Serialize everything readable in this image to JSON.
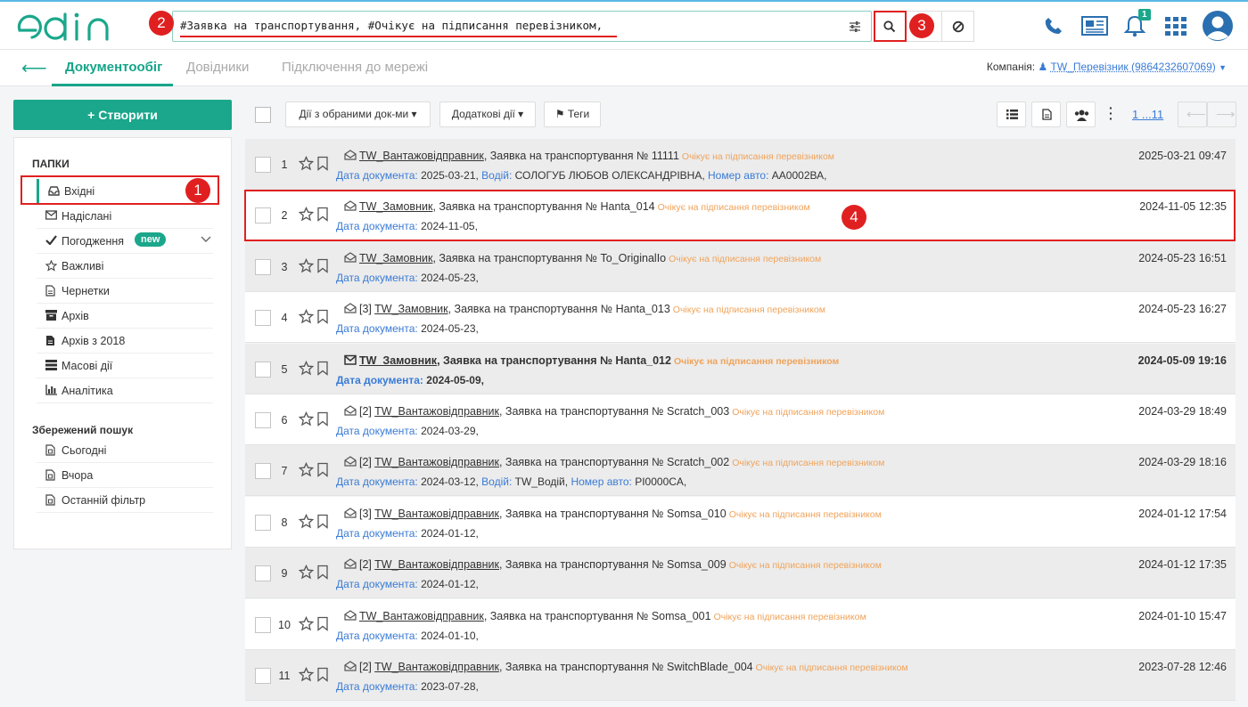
{
  "search": {
    "query": "#Заявка на транспортування, #Очікує на підписання перевізником,"
  },
  "markers": [
    "1",
    "2",
    "3",
    "4"
  ],
  "header": {
    "notifications_count": "1"
  },
  "nav": {
    "tabs": [
      "Документообіг",
      "Довідники",
      "Підключення до мережі"
    ],
    "company_label": "Компанія:",
    "company_value": "TW_Перевізник (9864232607069)"
  },
  "sidebar": {
    "create_label": "+ Створити",
    "folders_title": "ПАПКИ",
    "folders": [
      {
        "label": "Вхідні",
        "icon": "inbox-icon"
      },
      {
        "label": "Надіслані",
        "icon": "envelope-icon"
      },
      {
        "label": "Погодження",
        "icon": "check-icon",
        "badge": "new"
      },
      {
        "label": "Важливі",
        "icon": "star-icon"
      },
      {
        "label": "Чернетки",
        "icon": "draft-icon"
      },
      {
        "label": "Архів",
        "icon": "archive-icon"
      },
      {
        "label": "Архів з 2018",
        "icon": "archive-doc-icon"
      },
      {
        "label": "Масові дії",
        "icon": "bulk-icon"
      },
      {
        "label": "Аналітика",
        "icon": "chart-icon"
      }
    ],
    "saved_title": "Збережений пошук",
    "saved": [
      "Сьогодні",
      "Вчора",
      "Останній фільтр"
    ]
  },
  "toolbar": {
    "actions_label": "Дії з обраними док-ми ▾",
    "extra_label": "Додаткові дії ▾",
    "tags_label": "Теги",
    "pager": "1 ...11"
  },
  "rows": [
    {
      "num": "1",
      "prefix": "",
      "sender": "TW_Вантажовідправник",
      "title": ", Заявка на транспортування № 11111",
      "status": "Очікує на підписання перевізником",
      "fields": [
        [
          "Дата документа:",
          "2025-03-21,"
        ],
        [
          "Водій:",
          "СОЛОГУБ ЛЮБОВ ОЛЕКСАНДРІВНА,"
        ],
        [
          "Номер авто:",
          "АА0002ВА,"
        ]
      ],
      "date": "2025-03-21 09:47"
    },
    {
      "num": "2",
      "prefix": "",
      "sender": "TW_Замовник",
      "title": ", Заявка на транспортування № Hanta_014",
      "status": "Очікує на підписання перевізником",
      "fields": [
        [
          "Дата документа:",
          "2024-11-05,"
        ]
      ],
      "date": "2024-11-05 12:35"
    },
    {
      "num": "3",
      "prefix": "",
      "sender": "TW_Замовник",
      "title": ", Заявка на транспортування № To_OriginalIo",
      "status": "Очікує на підписання перевізником",
      "fields": [
        [
          "Дата документа:",
          "2024-05-23,"
        ]
      ],
      "date": "2024-05-23 16:51"
    },
    {
      "num": "4",
      "prefix": "[3]",
      "sender": "TW_Замовник",
      "title": ", Заявка на транспортування № Hanta_013",
      "status": "Очікує на підписання перевізником",
      "fields": [
        [
          "Дата документа:",
          "2024-05-23,"
        ]
      ],
      "date": "2024-05-23 16:27"
    },
    {
      "num": "5",
      "prefix": "",
      "sender": "TW_Замовник",
      "title": ", Заявка на транспортування № Hanta_012",
      "status": "Очікує на підписання перевізником",
      "fields": [
        [
          "Дата документа:",
          "2024-05-09,"
        ]
      ],
      "date": "2024-05-09 19:16"
    },
    {
      "num": "6",
      "prefix": "[2]",
      "sender": "TW_Вантажовідправник",
      "title": ", Заявка на транспортування № Scratch_003",
      "status": "Очікує на підписання перевізником",
      "fields": [
        [
          "Дата документа:",
          "2024-03-29,"
        ]
      ],
      "date": "2024-03-29 18:49"
    },
    {
      "num": "7",
      "prefix": "[2]",
      "sender": "TW_Вантажовідправник",
      "title": ", Заявка на транспортування № Scratch_002",
      "status": "Очікує на підписання перевізником",
      "fields": [
        [
          "Дата документа:",
          "2024-03-12,"
        ],
        [
          "Водій:",
          "TW_Водій,"
        ],
        [
          "Номер авто:",
          "PI0000CA,"
        ]
      ],
      "date": "2024-03-29 18:16"
    },
    {
      "num": "8",
      "prefix": "[3]",
      "sender": "TW_Вантажовідправник",
      "title": ", Заявка на транспортування № Somsa_010",
      "status": "Очікує на підписання перевізником",
      "fields": [
        [
          "Дата документа:",
          "2024-01-12,"
        ]
      ],
      "date": "2024-01-12 17:54"
    },
    {
      "num": "9",
      "prefix": "[2]",
      "sender": "TW_Вантажовідправник",
      "title": ", Заявка на транспортування № Somsa_009",
      "status": "Очікує на підписання перевізником",
      "fields": [
        [
          "Дата документа:",
          "2024-01-12,"
        ]
      ],
      "date": "2024-01-12 17:35"
    },
    {
      "num": "10",
      "prefix": "",
      "sender": "TW_Вантажовідправник",
      "title": ", Заявка на транспортування № Somsa_001",
      "status": "Очікує на підписання перевізником",
      "fields": [
        [
          "Дата документа:",
          "2024-01-10,"
        ]
      ],
      "date": "2024-01-10 15:47"
    },
    {
      "num": "11",
      "prefix": "[2]",
      "sender": "TW_Вантажовідправник",
      "title": ", Заявка на транспортування № SwitchBlade_004",
      "status": "Очікує на підписання перевізником",
      "fields": [
        [
          "Дата документа:",
          "2023-07-28,"
        ]
      ],
      "date": "2023-07-28 12:46"
    }
  ],
  "colors": {
    "accent": "#1aa78b",
    "link": "#3a7bd5",
    "status": "#f0a35a",
    "marker": "#e02020"
  }
}
